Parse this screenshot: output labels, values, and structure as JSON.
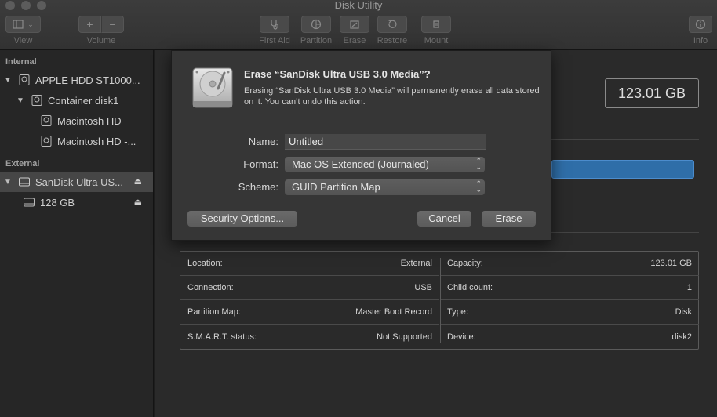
{
  "window": {
    "title": "Disk Utility"
  },
  "toolbar": {
    "view_label": "View",
    "volume_label": "Volume",
    "volume_add": "+",
    "volume_remove": "−",
    "first_aid_label": "First Aid",
    "partition_label": "Partition",
    "erase_label": "Erase",
    "restore_label": "Restore",
    "mount_label": "Mount",
    "info_label": "Info"
  },
  "sidebar": {
    "internal_header": "Internal",
    "external_header": "External",
    "items": [
      {
        "label": "APPLE HDD ST1000..."
      },
      {
        "label": "Container disk1"
      },
      {
        "label": "Macintosh HD"
      },
      {
        "label": "Macintosh HD -..."
      },
      {
        "label": "SanDisk Ultra US..."
      },
      {
        "label": "128 GB"
      }
    ],
    "eject_glyph": "⏏"
  },
  "main": {
    "capacity_display": "123.01 GB",
    "info_left": [
      {
        "label": "Location:",
        "value": "External"
      },
      {
        "label": "Connection:",
        "value": "USB"
      },
      {
        "label": "Partition Map:",
        "value": "Master Boot Record"
      },
      {
        "label": "S.M.A.R.T. status:",
        "value": "Not Supported"
      }
    ],
    "info_right": [
      {
        "label": "Capacity:",
        "value": "123.01 GB"
      },
      {
        "label": "Child count:",
        "value": "1"
      },
      {
        "label": "Type:",
        "value": "Disk"
      },
      {
        "label": "Device:",
        "value": "disk2"
      }
    ]
  },
  "dialog": {
    "title": "Erase “SanDisk Ultra USB 3.0 Media”?",
    "message": "Erasing “SanDisk Ultra USB 3.0 Media” will permanently erase all data stored on it. You can’t undo this action.",
    "name_label": "Name:",
    "name_value": "Untitled",
    "format_label": "Format:",
    "format_value": "Mac OS Extended (Journaled)",
    "scheme_label": "Scheme:",
    "scheme_value": "GUID Partition Map",
    "security_button": "Security Options...",
    "cancel_button": "Cancel",
    "erase_button": "Erase"
  },
  "colors": {
    "accent_blue": "#2f6ea8",
    "background": "#1e1e1e",
    "sheet_bg": "#363636"
  }
}
